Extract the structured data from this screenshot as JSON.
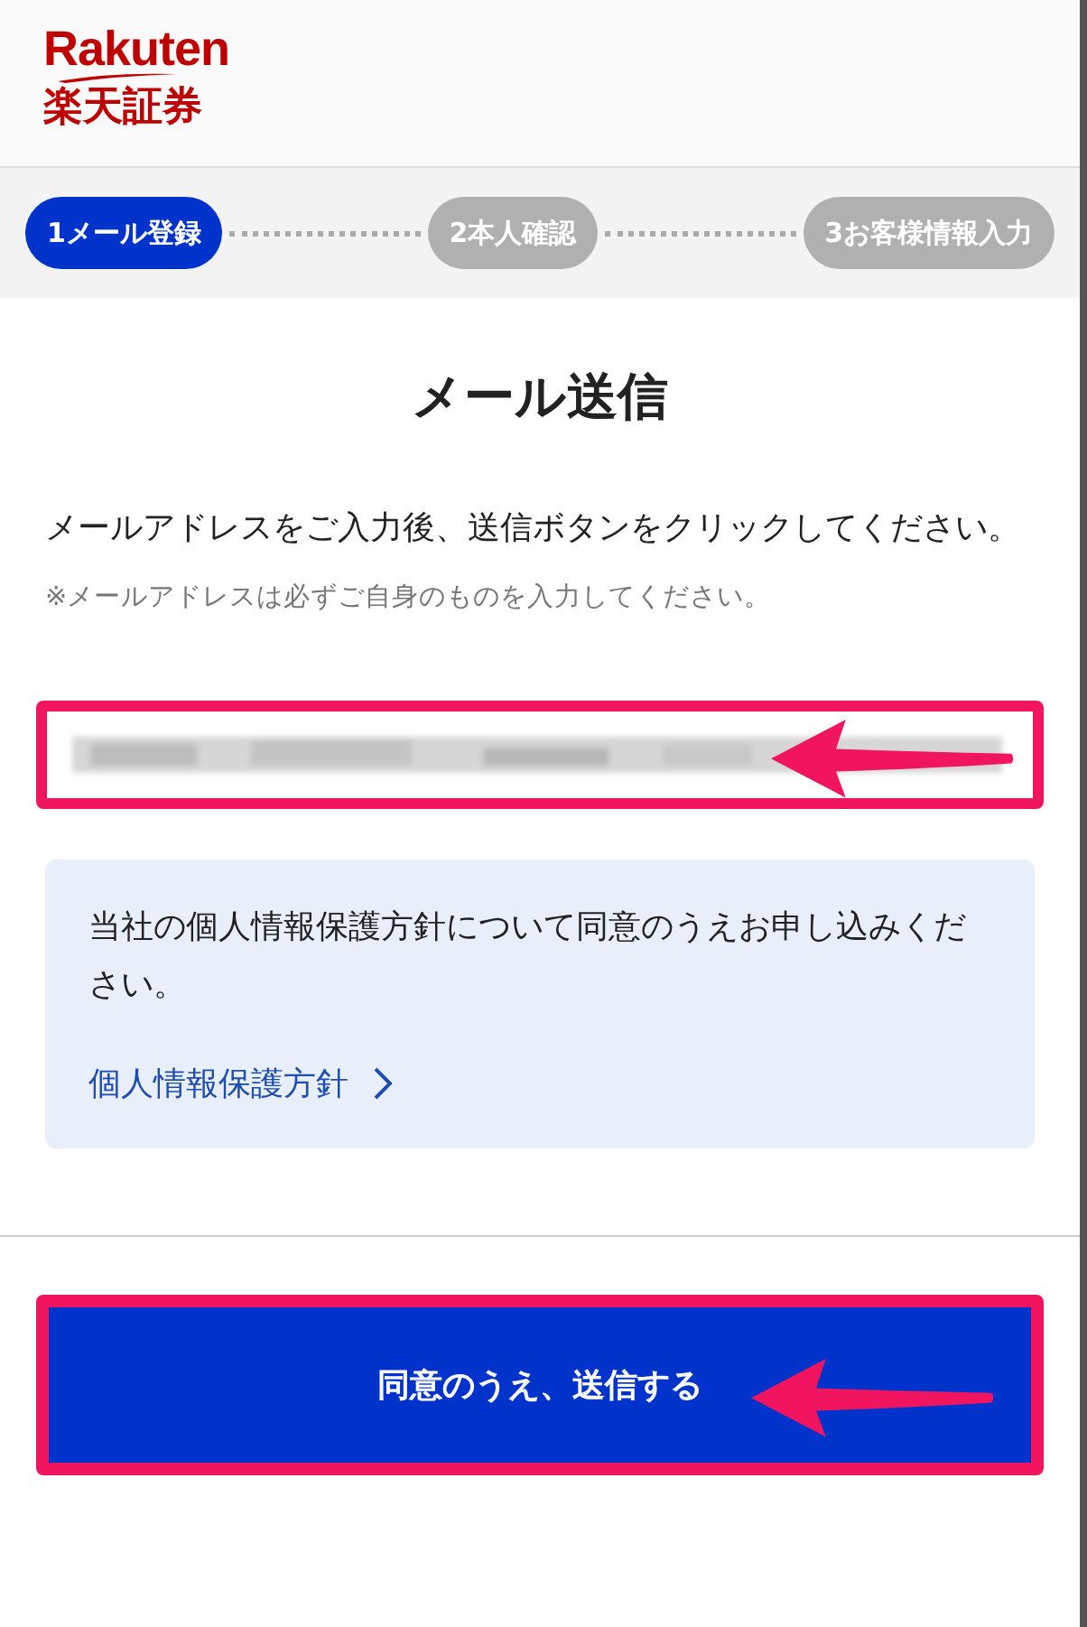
{
  "logo": {
    "wordmark": "Rakuten",
    "name": "楽天証券"
  },
  "steps": [
    {
      "number": "1",
      "label": "メール登録",
      "selected": true
    },
    {
      "number": "2",
      "label": "本人確認",
      "selected": false
    },
    {
      "number": "3",
      "label": "お客様情報入力",
      "selected": false
    }
  ],
  "title": "メール送信",
  "instruction": "メールアドレスをご入力後、送信ボタンをクリックしてください。",
  "note": "※メールアドレスは必ずご自身のものを入力してください。",
  "email_field": {
    "redacted": true,
    "highlighted": true
  },
  "privacy_box": {
    "text": "当社の個人情報保護方針について同意のうえお申し込みください。",
    "link": "個人情報保護方針"
  },
  "submit_button": {
    "label": "同意のうえ、送信する",
    "highlighted": true
  }
}
